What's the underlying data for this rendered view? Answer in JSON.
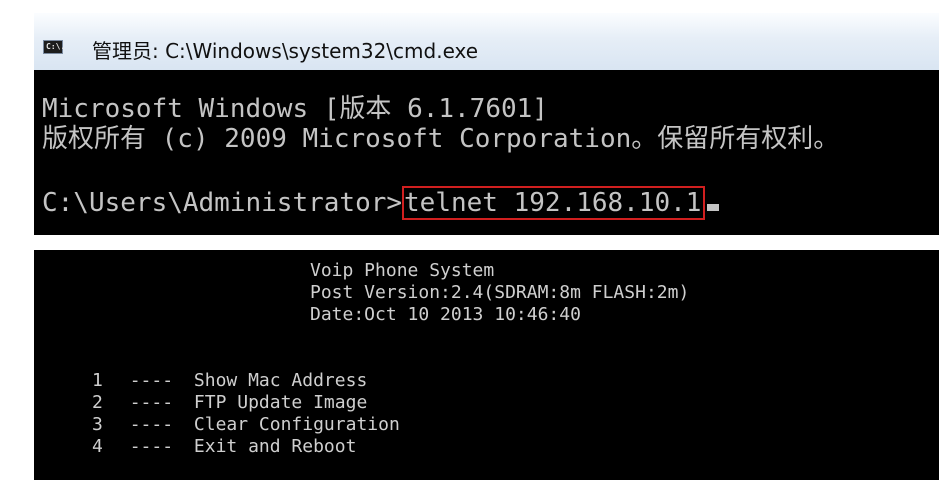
{
  "window": {
    "icon_text": "C:\\.",
    "title": "管理员: C:\\Windows\\system32\\cmd.exe"
  },
  "cmd": {
    "line1": "Microsoft Windows [版本 6.1.7601]",
    "line2": "版权所有 (c) 2009 Microsoft Corporation。保留所有权利。",
    "prompt": "C:\\Users\\Administrator>",
    "command": "telnet 192.168.10.1"
  },
  "telnet": {
    "header": [
      "Voip   Phone   System",
      "Post   Version:2.4(SDRAM:8m FLASH:2m)",
      "Date:Oct 10 2013   10:46:40"
    ],
    "menu": [
      {
        "num": "1",
        "sep": "----",
        "label": "Show Mac Address"
      },
      {
        "num": "2",
        "sep": "----",
        "label": "FTP Update Image"
      },
      {
        "num": "3",
        "sep": "----",
        "label": "Clear Configuration"
      },
      {
        "num": "4",
        "sep": "----",
        "label": "Exit and Reboot"
      }
    ]
  },
  "colors": {
    "terminal_bg": "#000000",
    "text": "#c4c4c4",
    "highlight_box": "#d11f1f"
  }
}
